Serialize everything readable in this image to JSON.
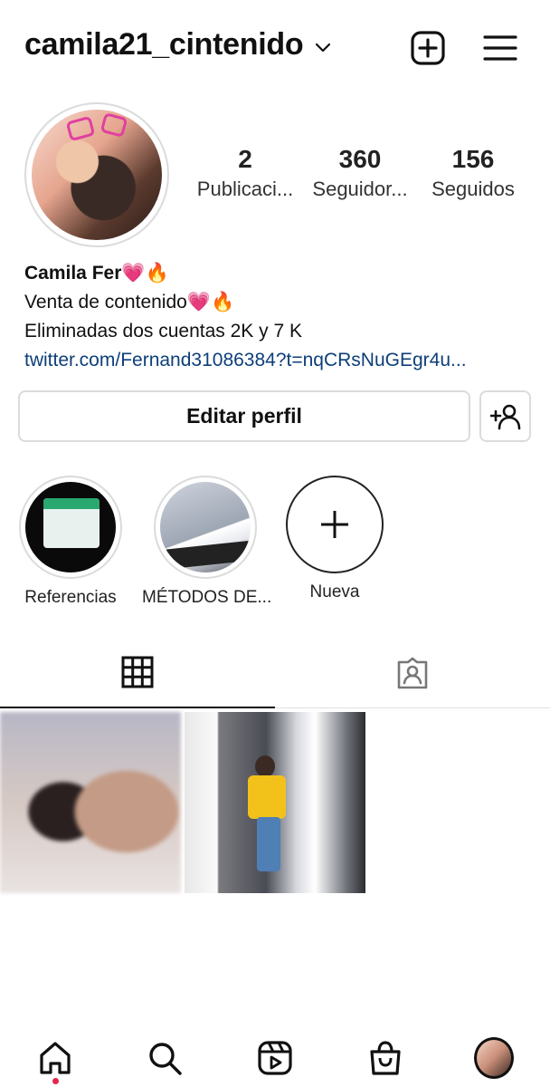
{
  "header": {
    "username": "camila21_cintenido",
    "dropdown_icon": "chevron-down-icon",
    "new_post_icon": "plus-square-icon",
    "menu_icon": "hamburger-menu-icon"
  },
  "stats": [
    {
      "value": "2",
      "label": "Publicaci..."
    },
    {
      "value": "360",
      "label": "Seguidor..."
    },
    {
      "value": "156",
      "label": "Seguidos"
    }
  ],
  "bio": {
    "name": "Camila Fer💗🔥",
    "line1": "Venta de contenido💗🔥",
    "line2": "Eliminadas dos cuentas 2K y 7 K",
    "link": "twitter.com/Fernand31086384?t=nqCRsNuGEgr4u..."
  },
  "buttons": {
    "edit_profile": "Editar perfil",
    "add_user_icon": "add-user-icon"
  },
  "highlights": [
    {
      "label": "Referencias"
    },
    {
      "label": "MÉTODOS DE..."
    },
    {
      "label": "Nueva"
    }
  ],
  "tabs": [
    {
      "icon": "grid-icon",
      "active": true
    },
    {
      "icon": "tagged-icon",
      "active": false
    }
  ],
  "nav": [
    {
      "icon": "home-icon",
      "active": true
    },
    {
      "icon": "search-icon"
    },
    {
      "icon": "reels-icon"
    },
    {
      "icon": "shop-icon"
    },
    {
      "icon": "profile-avatar"
    }
  ],
  "colors": {
    "link": "#0d3f7a",
    "border": "#dbdbdb",
    "notification_dot": "#e3264e"
  }
}
